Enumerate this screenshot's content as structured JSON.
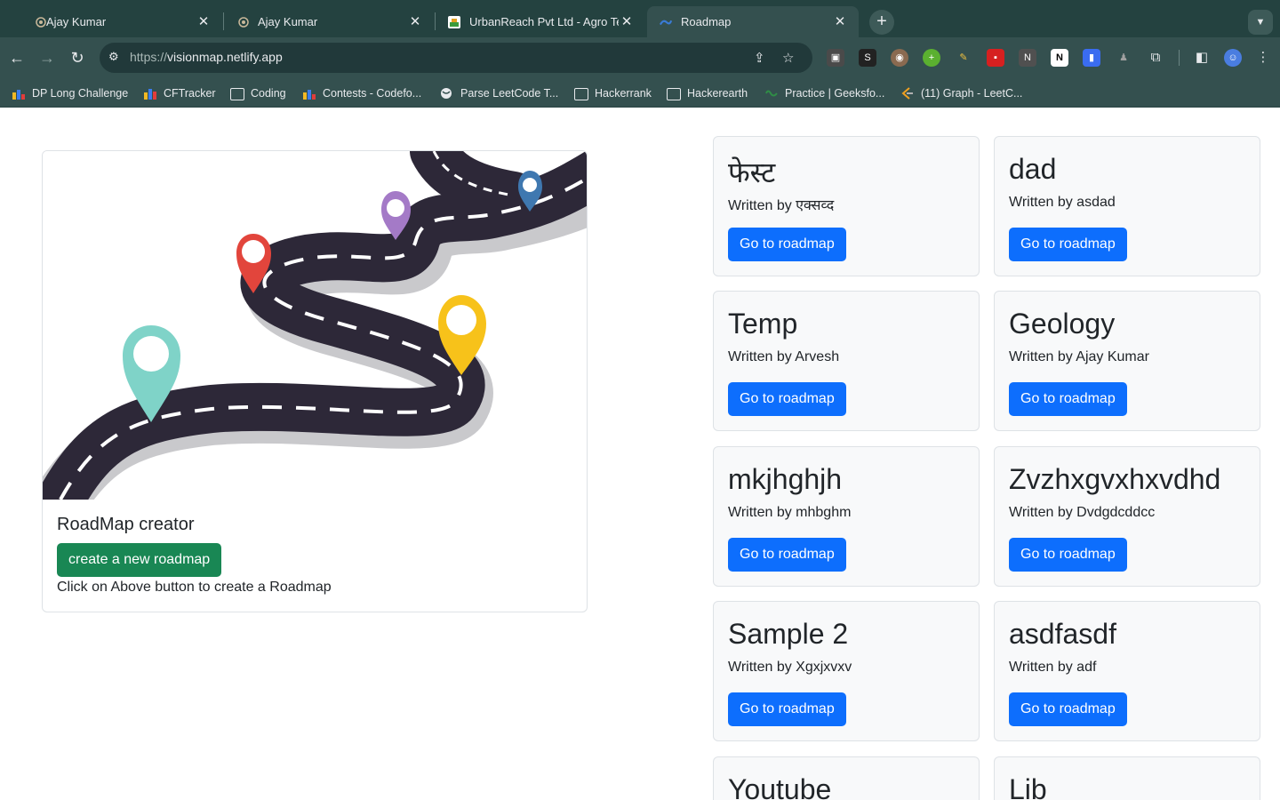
{
  "browser": {
    "tabs": [
      {
        "title": "Ajay Kumar",
        "icon": "codechef-favicon"
      },
      {
        "title": "Ajay Kumar",
        "icon": "codechef-favicon"
      },
      {
        "title": "UrbanReach Pvt Ltd - Agro Te",
        "icon": "urbanreach-favicon"
      },
      {
        "title": "Roadmap",
        "icon": "netlify-favicon",
        "active": true
      }
    ],
    "url_scheme": "https://",
    "url_host": "visionmap.netlify.app",
    "bookmarks": [
      {
        "label": "DP Long Challenge",
        "icon": "bar-chart-icon"
      },
      {
        "label": "CFTracker",
        "icon": "bar-chart-icon"
      },
      {
        "label": "Coding",
        "icon": "folder-icon"
      },
      {
        "label": "Contests - Codefo...",
        "icon": "bar-chart-icon"
      },
      {
        "label": "Parse LeetCode T...",
        "icon": "globe-icon"
      },
      {
        "label": "Hackerrank",
        "icon": "folder-icon"
      },
      {
        "label": "Hackerearth",
        "icon": "folder-icon"
      },
      {
        "label": "Practice | Geeksfo...",
        "icon": "gfg-icon"
      },
      {
        "label": "(11) Graph - LeetC...",
        "icon": "leetcode-icon"
      }
    ]
  },
  "creator": {
    "title": "RoadMap creator",
    "button_label": "create a new roadmap",
    "description": "Click on Above button to create a Roadmap"
  },
  "roadmaps": [
    {
      "title": "फेस्ट",
      "author": "Written by एक्सव्द",
      "button": "Go to roadmap"
    },
    {
      "title": "dad",
      "author": "Written by asdad",
      "button": "Go to roadmap"
    },
    {
      "title": "Temp",
      "author": "Written by Arvesh",
      "button": "Go to roadmap"
    },
    {
      "title": "Geology",
      "author": "Written by Ajay Kumar",
      "button": "Go to roadmap"
    },
    {
      "title": "mkjhghjh",
      "author": "Written by mhbghm",
      "button": "Go to roadmap"
    },
    {
      "title": "Zvzhxgvxhxvdhd",
      "author": "Written by Dvdgdcddcc",
      "button": "Go to roadmap"
    },
    {
      "title": "Sample 2",
      "author": "Written by Xgxjxvxv",
      "button": "Go to roadmap"
    },
    {
      "title": "asdfasdf",
      "author": "Written by adf",
      "button": "Go to roadmap"
    },
    {
      "title": "Youtube",
      "author": "",
      "button": ""
    },
    {
      "title": "Lib",
      "author": "",
      "button": ""
    }
  ],
  "colors": {
    "primary": "#0d6efd",
    "success": "#198754",
    "chrome_bg": "#34504f"
  }
}
